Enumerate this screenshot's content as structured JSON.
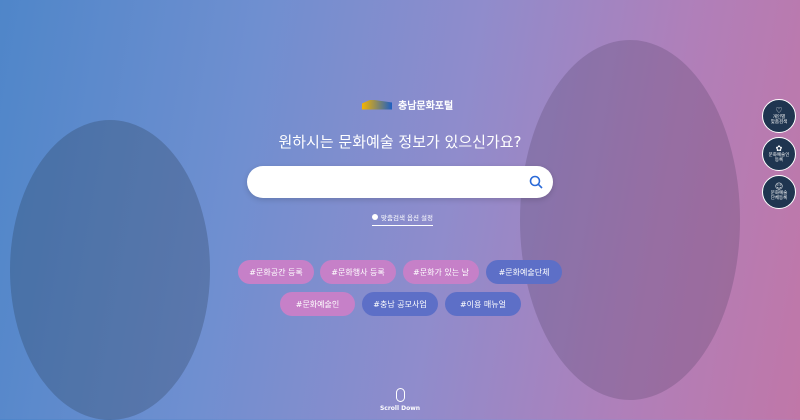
{
  "logo": {
    "text": "충남문화포털"
  },
  "question": "원하시는 문화예술 정보가 있으신가요?",
  "search": {
    "placeholder": "",
    "value": ""
  },
  "option_link": "맞춤검색 옵션 설정",
  "tags": [
    "#문화공간 등록",
    "#문화행사 등록",
    "#문화가 있는 날",
    "#문화예술단체",
    "#문화예술인",
    "#충남 공모사업",
    "#이용 매뉴얼"
  ],
  "side_buttons": [
    {
      "line1": "개인별",
      "line2": "맞춤검색",
      "icon": "heart-search-icon"
    },
    {
      "line1": "문화예술인",
      "line2": "등록",
      "icon": "film-reel-icon"
    },
    {
      "line1": "문화예술",
      "line2": "단체등록",
      "icon": "group-icon"
    }
  ],
  "scroll": "Scroll Down"
}
